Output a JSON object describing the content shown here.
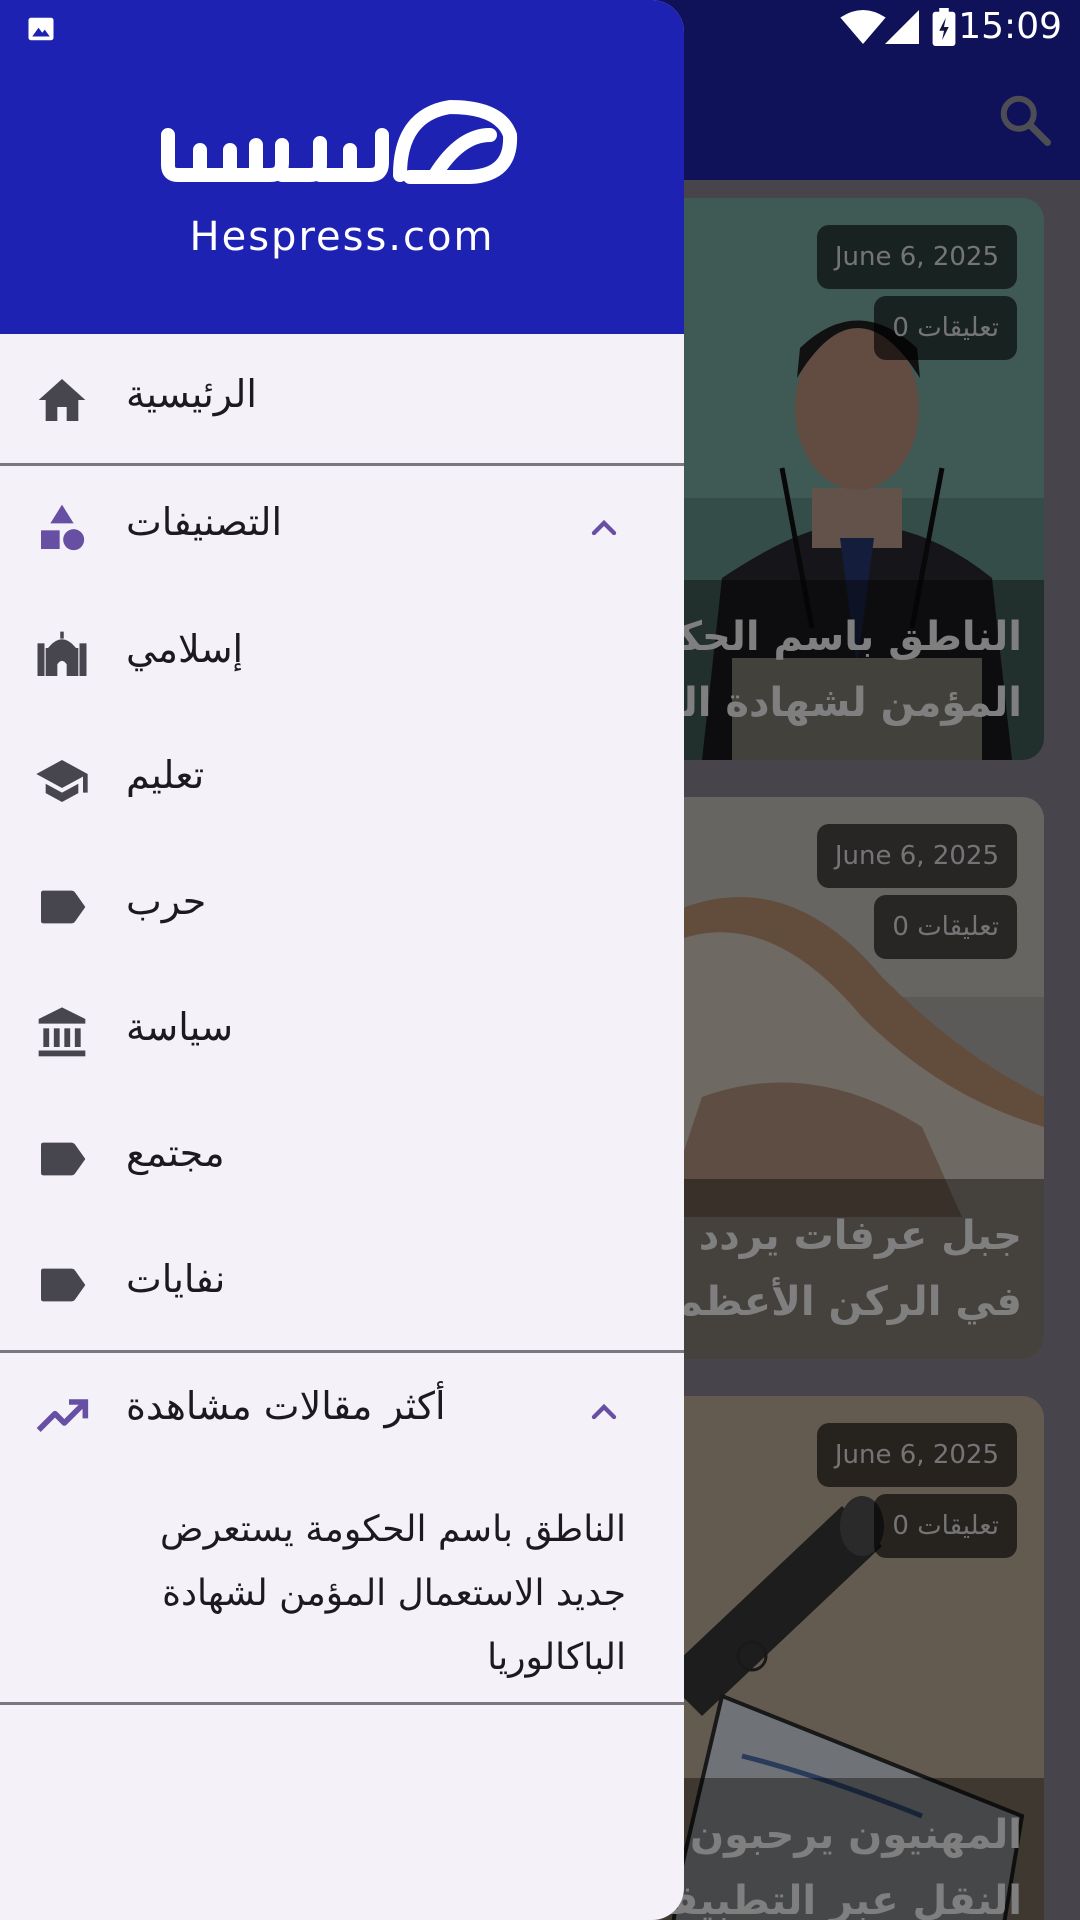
{
  "status_bar": {
    "time": "15:09"
  },
  "app_bar": {
    "icon": "search-icon"
  },
  "drawer": {
    "brand": {
      "site_name": "Hespress.com",
      "logo_text": "هسبريس"
    },
    "home": {
      "label": "الرئيسية",
      "icon": "home-icon"
    },
    "categories": {
      "label": "التصنيفات",
      "icon": "categories-shapes-icon",
      "expanded": true,
      "items": [
        {
          "label": "إسلامي",
          "icon": "mosque-icon"
        },
        {
          "label": "تعليم",
          "icon": "graduation-cap-icon"
        },
        {
          "label": "حرب",
          "icon": "label-tag-icon"
        },
        {
          "label": "سياسة",
          "icon": "bank-building-icon"
        },
        {
          "label": "مجتمع",
          "icon": "label-tag-icon"
        },
        {
          "label": "نفايات",
          "icon": "label-tag-icon"
        }
      ]
    },
    "popular": {
      "label": "أكثر مقالات مشاهدة",
      "icon": "trending-up-icon",
      "expanded": true,
      "article_lines": [
        "الناطق باسم الحكومة يستعرض",
        "جديد الاستعمال المؤمن لشهادة",
        "الباكالوريا"
      ]
    }
  },
  "feed": {
    "cards": [
      {
        "date": "June 6, 2025",
        "comments": "تعليقات 0",
        "title_lines": [
          "الناطق باسم الحكومة",
          "المؤمن لشهادة الباكالوريا"
        ]
      },
      {
        "date": "June 6, 2025",
        "comments": "تعليقات 0",
        "title_lines": [
          "جبل عرفات يردد نداء",
          "في الركن الأعظم"
        ]
      },
      {
        "date": "June 6, 2025",
        "comments": "تعليقات 0",
        "title_lines": [
          "المهنيون يرحبون",
          "النقل عبر التطبيقات"
        ]
      }
    ]
  },
  "colors": {
    "primary": "#1e22b3",
    "drawer_bg": "#f5f1f9",
    "accent_icon": "#6750a4",
    "text": "#1b1b1f"
  }
}
